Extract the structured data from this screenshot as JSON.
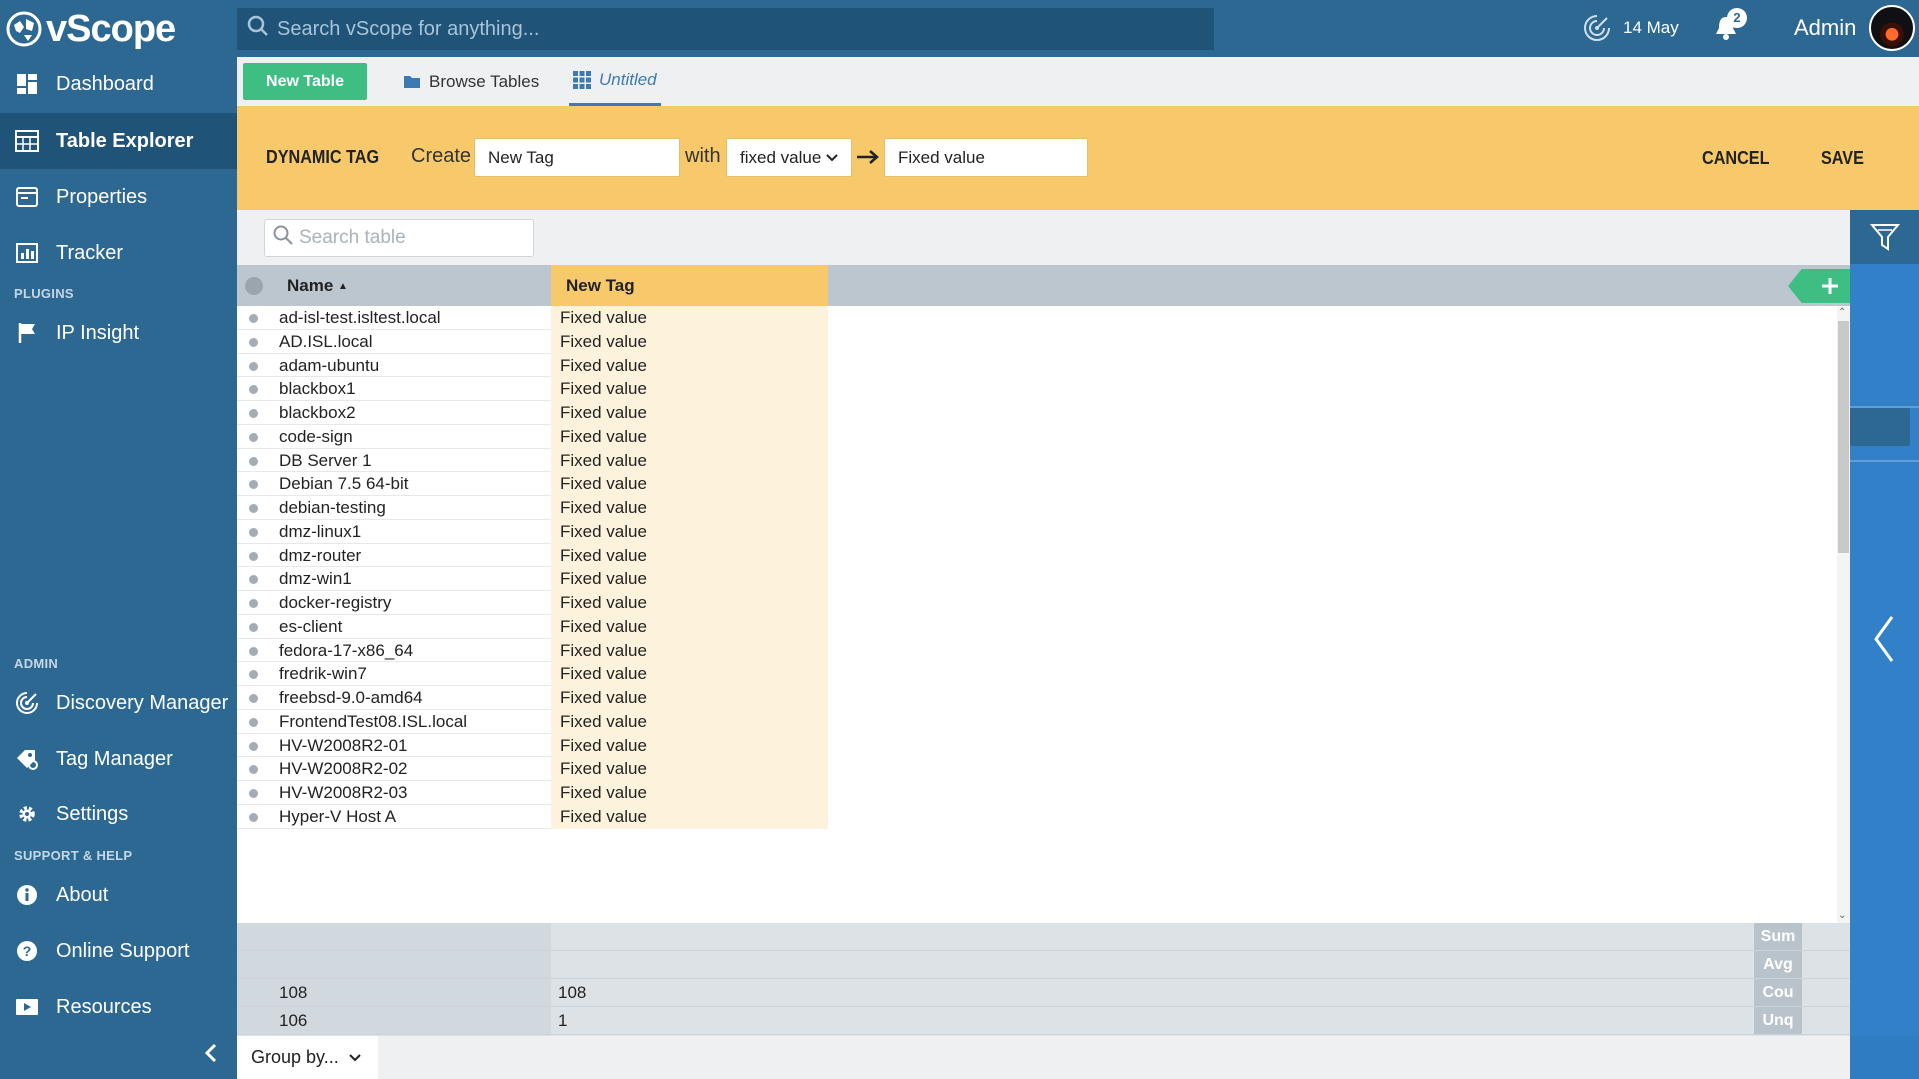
{
  "app": {
    "logo_text": "vScope"
  },
  "sidebar": {
    "main_items": [
      {
        "label": "Dashboard",
        "icon": "dashboard-icon"
      },
      {
        "label": "Table Explorer",
        "icon": "table-icon",
        "active": true
      },
      {
        "label": "Properties",
        "icon": "properties-icon"
      },
      {
        "label": "Tracker",
        "icon": "tracker-icon"
      }
    ],
    "plugins_label": "PLUGINS",
    "plugin_items": [
      {
        "label": "IP Insight",
        "icon": "flag-icon"
      }
    ],
    "admin_label": "ADMIN",
    "admin_items": [
      {
        "label": "Discovery Manager",
        "icon": "discovery-icon"
      },
      {
        "label": "Tag Manager",
        "icon": "tags-icon"
      },
      {
        "label": "Settings",
        "icon": "gear-icon"
      }
    ],
    "support_label": "SUPPORT & HELP",
    "support_items": [
      {
        "label": "About",
        "icon": "info-icon"
      },
      {
        "label": "Online Support",
        "icon": "question-icon"
      },
      {
        "label": "Resources",
        "icon": "play-icon"
      }
    ]
  },
  "topbar": {
    "search_placeholder": "Search vScope for anything...",
    "date": "14 May",
    "notification_count": "2",
    "user": "Admin"
  },
  "tabs": {
    "new_table": "New Table",
    "browse": "Browse Tables",
    "current": "Untitled"
  },
  "dynamic_tag": {
    "title": "DYNAMIC TAG",
    "create_label": "Create",
    "tag_name": "New Tag",
    "with_label": "with",
    "mode": "fixed value",
    "value": "Fixed value",
    "cancel": "CANCEL",
    "save": "SAVE"
  },
  "table": {
    "search_placeholder": "Search table",
    "columns": [
      "Name",
      "New Tag"
    ],
    "sort_indicator": "▲",
    "rows": [
      [
        "ad-isl-test.isltest.local",
        "Fixed value"
      ],
      [
        "AD.ISL.local",
        "Fixed value"
      ],
      [
        "adam-ubuntu",
        "Fixed value"
      ],
      [
        "blackbox1",
        "Fixed value"
      ],
      [
        "blackbox2",
        "Fixed value"
      ],
      [
        "code-sign",
        "Fixed value"
      ],
      [
        "DB Server 1",
        "Fixed value"
      ],
      [
        "Debian 7.5 64-bit",
        "Fixed value"
      ],
      [
        "debian-testing",
        "Fixed value"
      ],
      [
        "dmz-linux1",
        "Fixed value"
      ],
      [
        "dmz-router",
        "Fixed value"
      ],
      [
        "dmz-win1",
        "Fixed value"
      ],
      [
        "docker-registry",
        "Fixed value"
      ],
      [
        "es-client",
        "Fixed value"
      ],
      [
        "fedora-17-x86_64",
        "Fixed value"
      ],
      [
        "fredrik-win7",
        "Fixed value"
      ],
      [
        "freebsd-9.0-amd64",
        "Fixed value"
      ],
      [
        "FrontendTest08.ISL.local",
        "Fixed value"
      ],
      [
        "HV-W2008R2-01",
        "Fixed value"
      ],
      [
        "HV-W2008R2-02",
        "Fixed value"
      ],
      [
        "HV-W2008R2-03",
        "Fixed value"
      ],
      [
        "Hyper-V Host A",
        "Fixed value"
      ]
    ],
    "footer": [
      {
        "agg": "Sum",
        "name": "",
        "tag": ""
      },
      {
        "agg": "Avg",
        "name": "",
        "tag": ""
      },
      {
        "agg": "Cou",
        "name": "108",
        "tag": "108"
      },
      {
        "agg": "Unq",
        "name": "106",
        "tag": "1"
      }
    ],
    "group_by": "Group by..."
  },
  "colors": {
    "sidebar": "#2c6892",
    "accent_green": "#3fbe84",
    "tag_yellow": "#f7c96a",
    "rail_blue": "#3281c8"
  }
}
